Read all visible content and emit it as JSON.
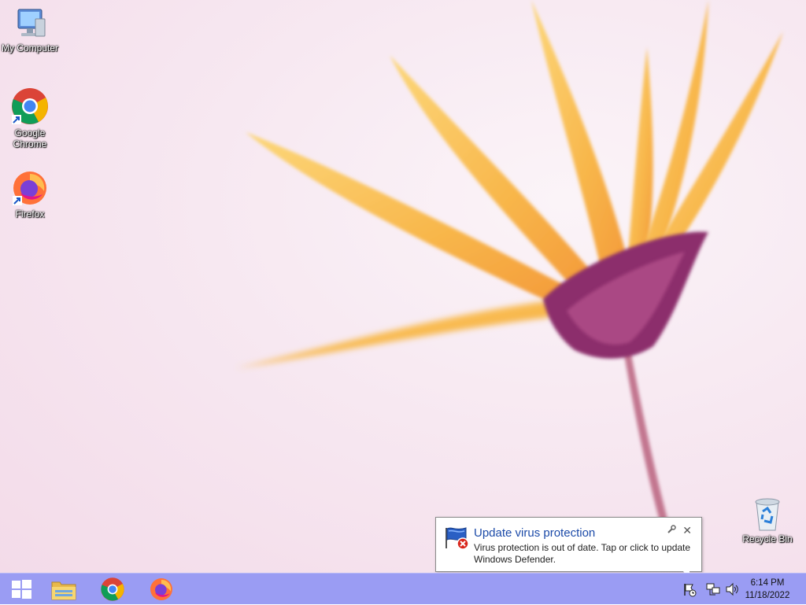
{
  "desktop": {
    "icons": [
      {
        "label": "My Computer"
      },
      {
        "label": "Google Chrome"
      },
      {
        "label": "Firefox"
      },
      {
        "label": "Recycle Bin"
      }
    ]
  },
  "notification": {
    "title": "Update virus protection",
    "message": "Virus protection is out of date. Tap or click to update Windows Defender."
  },
  "taskbar": {
    "color": "#9a9cf3",
    "pinned": [
      {
        "icon": "windows-start-icon"
      },
      {
        "icon": "file-explorer-icon"
      },
      {
        "icon": "chrome-icon"
      },
      {
        "icon": "firefox-icon"
      }
    ]
  },
  "clock": {
    "time": "6:14 PM",
    "date": "11/18/2022"
  }
}
